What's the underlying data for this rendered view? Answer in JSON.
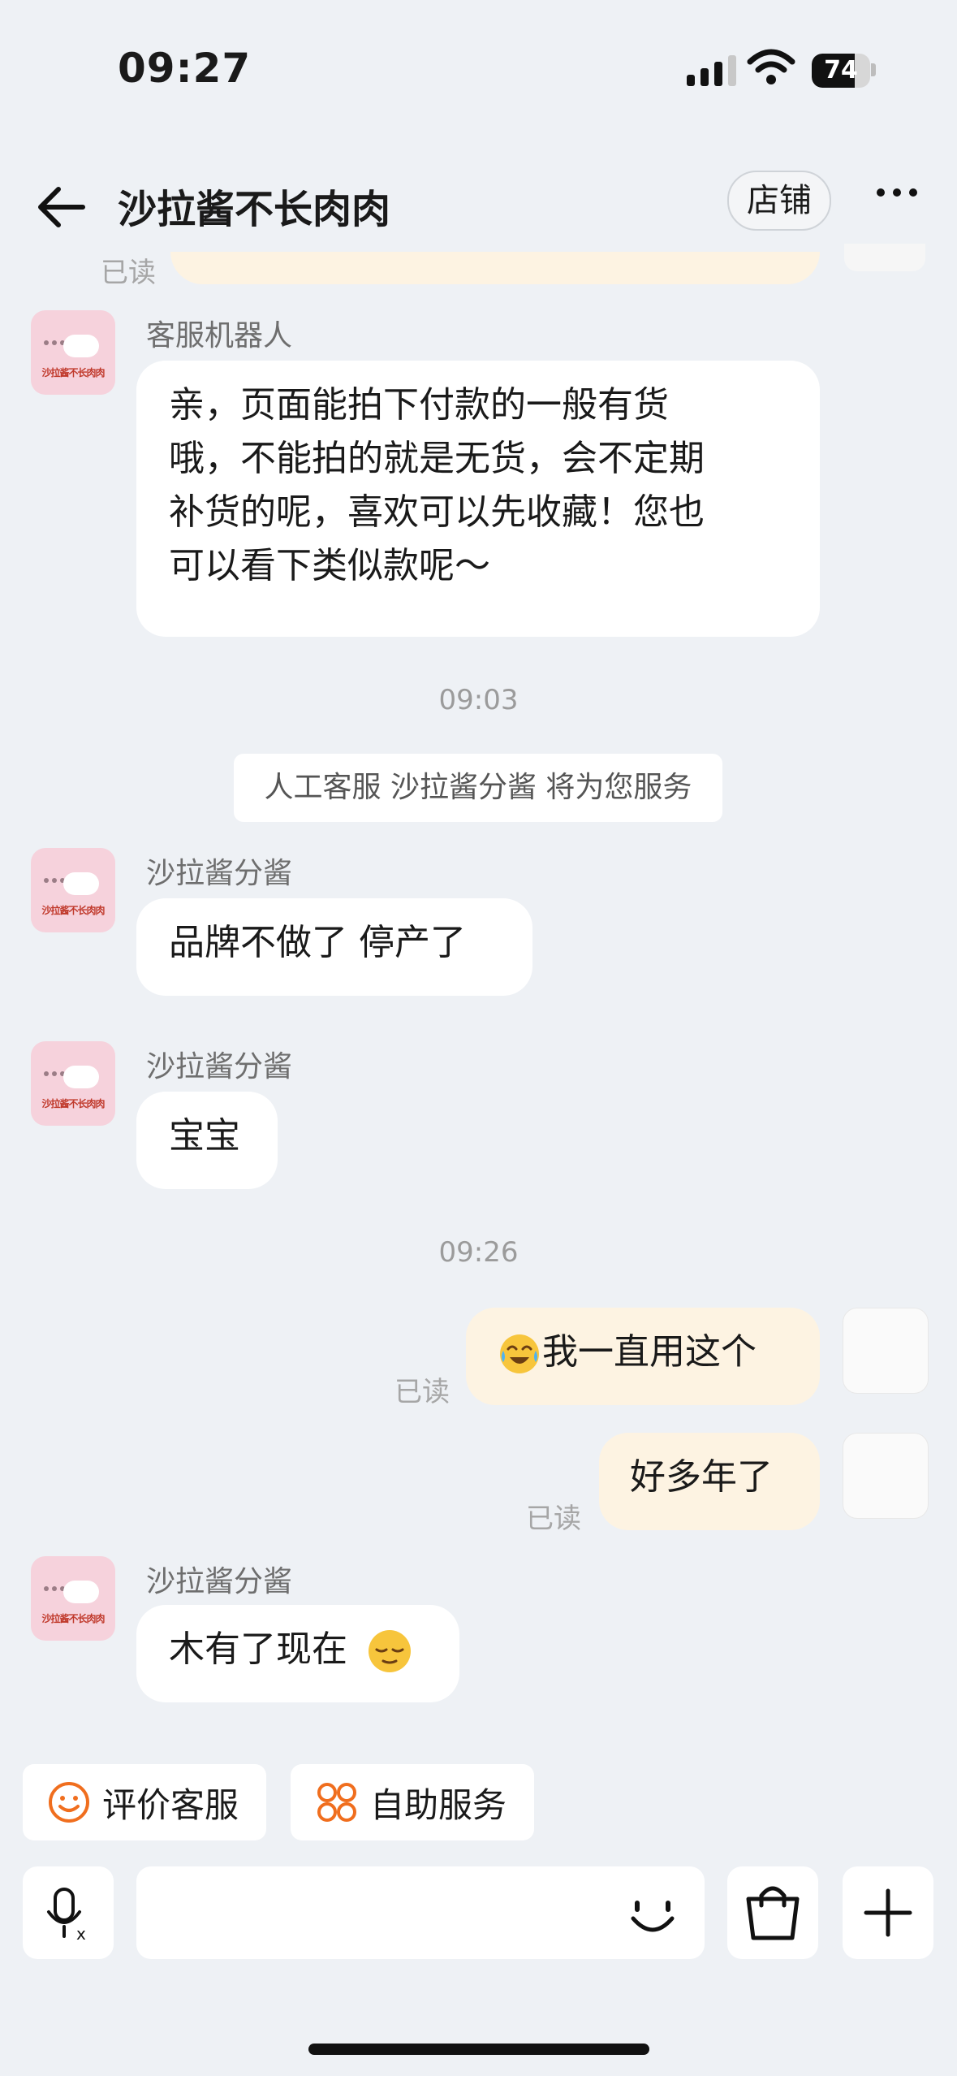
{
  "status_bar": {
    "time": "09:27",
    "battery": "74",
    "battery_level": 0.74
  },
  "header": {
    "title": "沙拉酱不长肉肉",
    "shop_button": "店铺"
  },
  "messages": {
    "read_label": "已读",
    "bot_sender": "客服机器人",
    "bot_text": "亲，页面能拍下付款的一般有货哦，不能拍的就是无货，会不定期补货的呢，喜欢可以先收藏！您也可以看下类似款呢～",
    "bot_lines": [
      "亲，页面能拍下付款的一般有货",
      "哦，不能拍的就是无货，会不定期",
      "补货的呢，喜欢可以先收藏！您也",
      "可以看下类似款呢～"
    ],
    "time1": "09:03",
    "system_notice": "人工客服 沙拉酱分酱 将为您服务",
    "agent_sender": "沙拉酱分酱",
    "agent_msg1": "品牌不做了 停产了",
    "agent_msg2": "宝宝",
    "time2": "09:26",
    "my_msg1": "我一直用这个",
    "my_msg2": "好多年了",
    "agent_msg3": "木有了现在",
    "avatar_text": "沙拉酱不长肉肉"
  },
  "quick_actions": {
    "rate": "评价客服",
    "self_service": "自助服务"
  },
  "icons": [
    "back-arrow-icon",
    "more-icon",
    "smile-icon",
    "grid-icon",
    "voice-icon",
    "emoji-icon",
    "bag-icon",
    "plus-icon"
  ],
  "colors": {
    "accent_orange": "#f06e1e",
    "my_bubble": "#fdf3e2",
    "background": "#eef1f5"
  }
}
